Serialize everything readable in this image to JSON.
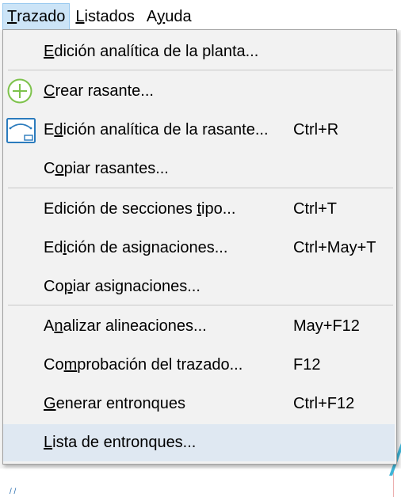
{
  "menubar": [
    {
      "pre": "",
      "ul": "T",
      "post": "razado",
      "open": true
    },
    {
      "pre": "",
      "ul": "L",
      "post": "istados",
      "open": false
    },
    {
      "pre": "A",
      "ul": "y",
      "post": "uda",
      "open": false
    }
  ],
  "menu": [
    {
      "pre": "",
      "ul": "E",
      "post": "dición analítica de la planta...",
      "shortcut": "",
      "icon": ""
    },
    {
      "pre": "",
      "ul": "C",
      "post": "rear rasante...",
      "shortcut": "",
      "icon": "plus-circle-icon"
    },
    {
      "pre": "E",
      "ul": "d",
      "post": "ición analítica de la rasante...",
      "shortcut": "Ctrl+R",
      "icon": "profile-window-icon"
    },
    {
      "pre": "C",
      "ul": "o",
      "post": "piar rasantes...",
      "shortcut": "",
      "icon": ""
    },
    {
      "pre": "Edición de secciones ",
      "ul": "t",
      "post": "ipo...",
      "shortcut": "Ctrl+T",
      "icon": ""
    },
    {
      "pre": "Ed",
      "ul": "i",
      "post": "ción de asignaciones...",
      "shortcut": "Ctrl+May+T",
      "icon": ""
    },
    {
      "pre": "Co",
      "ul": "p",
      "post": "iar asignaciones...",
      "shortcut": "",
      "icon": ""
    },
    {
      "pre": "A",
      "ul": "n",
      "post": "alizar alineaciones...",
      "shortcut": "May+F12",
      "icon": ""
    },
    {
      "pre": "Co",
      "ul": "m",
      "post": "probación del trazado...",
      "shortcut": "F12",
      "icon": ""
    },
    {
      "pre": "",
      "ul": "G",
      "post": "enerar entronques",
      "shortcut": "Ctrl+F12",
      "icon": ""
    },
    {
      "pre": "",
      "ul": "L",
      "post": "ista de entronques...",
      "shortcut": "",
      "icon": ""
    }
  ],
  "colors": {
    "hover": "#dfe8f2",
    "menubar_open": "#cce4f7",
    "plus_icon": "#7dc24b",
    "window_icon": "#2b7bbd"
  }
}
